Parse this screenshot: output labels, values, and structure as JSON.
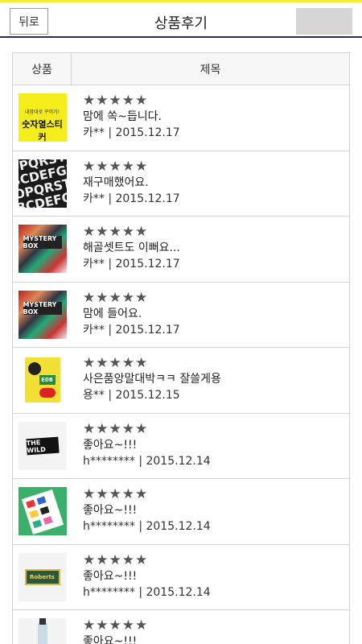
{
  "header": {
    "back_label": "뒤로",
    "title": "상품후기"
  },
  "table": {
    "col_product": "상품",
    "col_title": "제목"
  },
  "reviews": [
    {
      "stars": "★★★★★",
      "text": "맘에 쏙~듭니다.",
      "meta": "카** | 2015.12.17",
      "thumb_text_small": "내맘대로 꾸미기!",
      "thumb_text_big": "숫자열스티커"
    },
    {
      "stars": "★★★★★",
      "text": "재구매했어요.",
      "meta": "카** | 2015.12.17",
      "thumb_lines": [
        "NOPQRSTUV",
        "ABCDEFGHIJ",
        "NOPQRSTUV",
        "ABCDEFGHIJ"
      ]
    },
    {
      "stars": "★★★★★",
      "text": "해골셋트도 이뻐요...",
      "meta": "카** | 2015.12.17",
      "thumb_label": "MYSTERY BOX"
    },
    {
      "stars": "★★★★★",
      "text": "맘에 들어요.",
      "meta": "카** | 2015.12.17",
      "thumb_label": "MYSTERY BOX"
    },
    {
      "stars": "★★★★★",
      "text": "사은품앙말대박ㅋㅋ 잘쓸게용",
      "meta": "용** | 2015.12.15",
      "thumb_label": "E08"
    },
    {
      "stars": "★★★★★",
      "text": "좋아요~!!!",
      "meta": "h******** | 2015.12.14",
      "thumb_label": "THE WILD"
    },
    {
      "stars": "★★★★★",
      "text": "좋아요~!!!",
      "meta": "h******** | 2015.12.14"
    },
    {
      "stars": "★★★★★",
      "text": "좋아요~!!!",
      "meta": "h******** | 2015.12.14",
      "thumb_label": "Roberts"
    },
    {
      "stars": "★★★★★",
      "text": "좋아요~!!!",
      "meta": ""
    }
  ]
}
